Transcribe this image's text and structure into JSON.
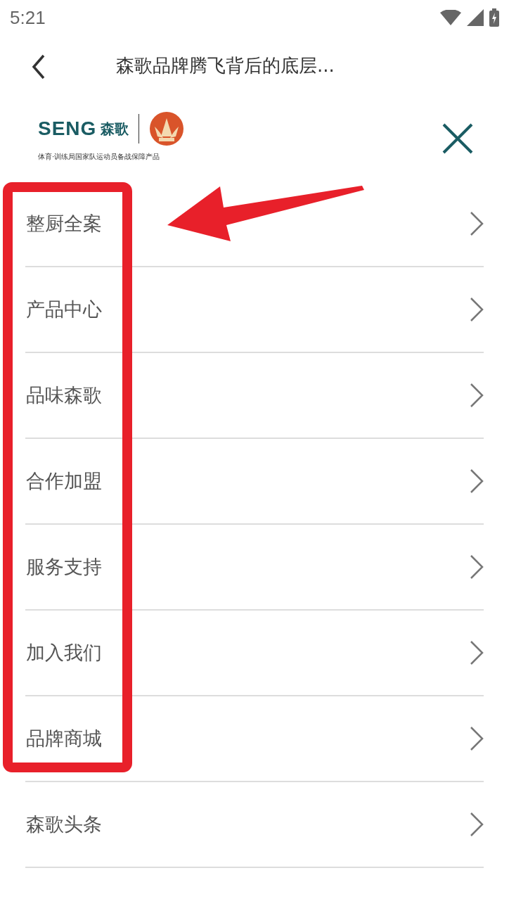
{
  "status_bar": {
    "time": "5:21"
  },
  "header": {
    "title": "森歌品牌腾飞背后的底层..."
  },
  "logo": {
    "wordmark": "SENG",
    "name": "森歌",
    "tagline": "体育·训练局国家队运动员备战保障产品"
  },
  "menu": {
    "items": [
      {
        "label": "整厨全案"
      },
      {
        "label": "产品中心"
      },
      {
        "label": "品味森歌"
      },
      {
        "label": "合作加盟"
      },
      {
        "label": "服务支持"
      },
      {
        "label": "加入我们"
      },
      {
        "label": "品牌商城"
      },
      {
        "label": "森歌头条"
      }
    ]
  }
}
